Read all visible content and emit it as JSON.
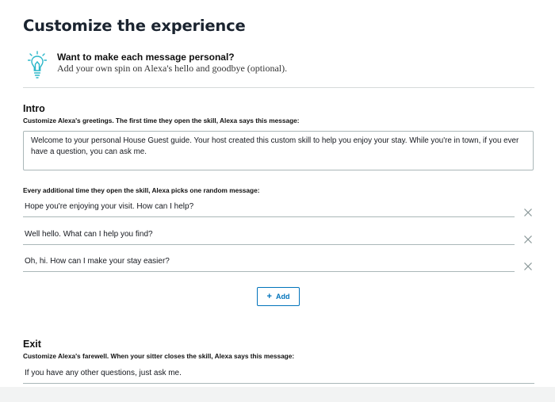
{
  "page": {
    "title": "Customize the experience"
  },
  "tip": {
    "icon": "lightbulb-icon",
    "heading": "Want to make each message personal?",
    "subtext": "Add your own spin on Alexa's hello and goodbye (optional)."
  },
  "intro": {
    "title": "Intro",
    "caption": "Customize Alexa's greetings. The first time they open the skill, Alexa says this message:",
    "first_message": "Welcome to your personal House Guest guide. Your host created this custom skill to help you enjoy your stay. While you're in town, if you ever have a question, you can ask me.",
    "random_caption": "Every additional time they open the skill, Alexa picks one random message:",
    "random_messages": [
      "Hope you're enjoying your visit. How can I help?",
      "Well hello. What can I help you find?",
      "Oh, hi. How can I make your stay easier?"
    ],
    "remove_icon": "close-icon",
    "add_label": "Add"
  },
  "exit": {
    "title": "Exit",
    "caption": "Customize Alexa's farewell. When your sitter closes the skill, Alexa says this message:",
    "message": "If you have any other questions, just ask me."
  },
  "colors": {
    "accent": "#0073bb",
    "icon_teal": "#2bb7c9",
    "border": "#aab7b8"
  }
}
